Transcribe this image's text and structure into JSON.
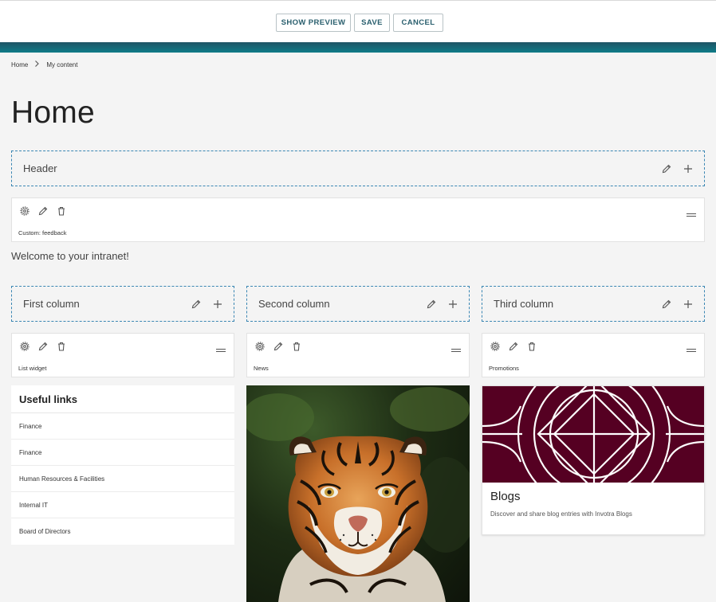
{
  "toolbar": {
    "show_preview": "SHOW PREVIEW",
    "save": "SAVE",
    "cancel": "CANCEL"
  },
  "breadcrumb": {
    "home": "Home",
    "current": "My content"
  },
  "page_title": "Home",
  "header_zone": {
    "label": "Header"
  },
  "feedback_widget": {
    "name": "Custom: feedback"
  },
  "welcome_text": "Welcome to your intranet!",
  "columns": [
    {
      "label": "First column",
      "widget": "List widget"
    },
    {
      "label": "Second column",
      "widget": "News"
    },
    {
      "label": "Third column",
      "widget": "Promotions"
    }
  ],
  "useful_links": {
    "title": "Useful links",
    "items": [
      "Finance",
      "Finance",
      "Human Resources & Facilities",
      "Internal IT",
      "Board of Directors"
    ]
  },
  "blogs": {
    "title": "Blogs",
    "description": "Discover and share blog entries with Invotra Blogs"
  },
  "icons": {
    "settings": "gear-icon",
    "edit": "pencil-icon",
    "delete": "trash-icon",
    "add": "plus-icon",
    "drag": "drag-handle-icon",
    "breadcrumb_separator": "chevron-right-icon"
  },
  "colors": {
    "accent": "#0f7c88",
    "zone_border": "#3a86b3",
    "promo_banner": "#550022",
    "button_text": "#2a5f6e"
  }
}
